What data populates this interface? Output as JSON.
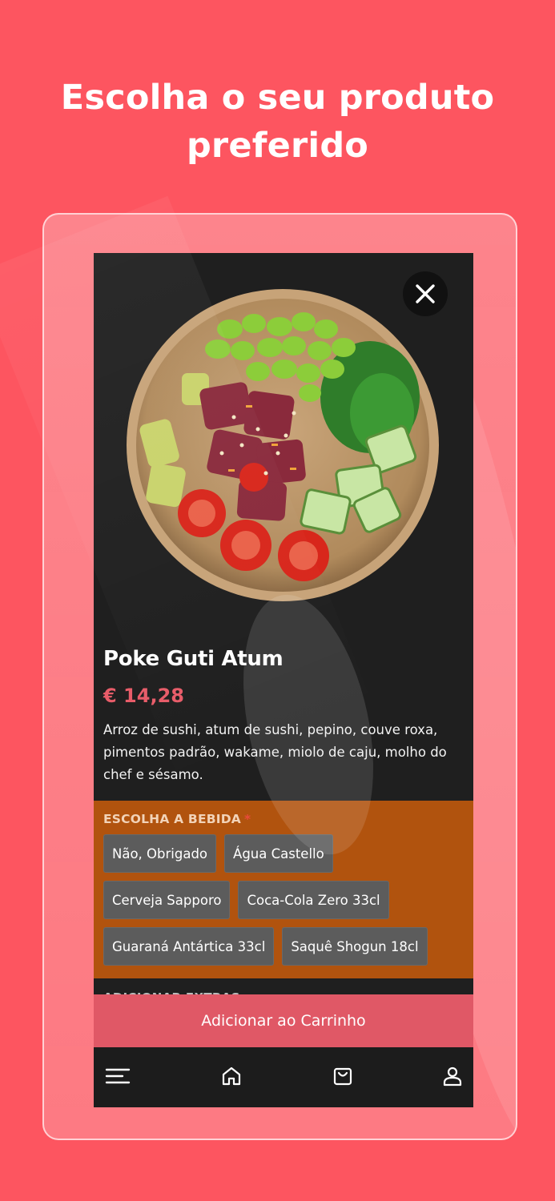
{
  "headline": {
    "line1": "Escolha o seu produto",
    "line2": "preferido"
  },
  "product": {
    "title": "Poke Guti Atum",
    "price": "€ 14,28",
    "description": "Arroz de sushi, atum de sushi, pepino, couve roxa, pimentos padrão, wakame, miolo de caju, molho do chef e sésamo."
  },
  "drink_section": {
    "heading": "ESCOLHA A BEBIDA",
    "required_marker": "*",
    "options": [
      "Não, Obrigado",
      "Água Castello",
      "Cerveja Sapporo",
      "Coca-Cola Zero 33cl",
      "Guaraná Antártica 33cl",
      "Saquê Shogun 18cl"
    ]
  },
  "extras_section": {
    "heading": "ADICIONAR EXTRAS"
  },
  "cart": {
    "button_label": "Adicionar ao Carrinho"
  },
  "icons": {
    "close": "close-icon",
    "menu": "menu-icon",
    "home": "home-icon",
    "cart": "shopping-bag-icon",
    "profile": "user-icon"
  },
  "colors": {
    "background": "#fd5560",
    "screen": "#1f1f1f",
    "price": "#e85c69",
    "drink_section": "#b1530e",
    "chip": "#5c5c5c",
    "cart_button": "#e05866"
  }
}
